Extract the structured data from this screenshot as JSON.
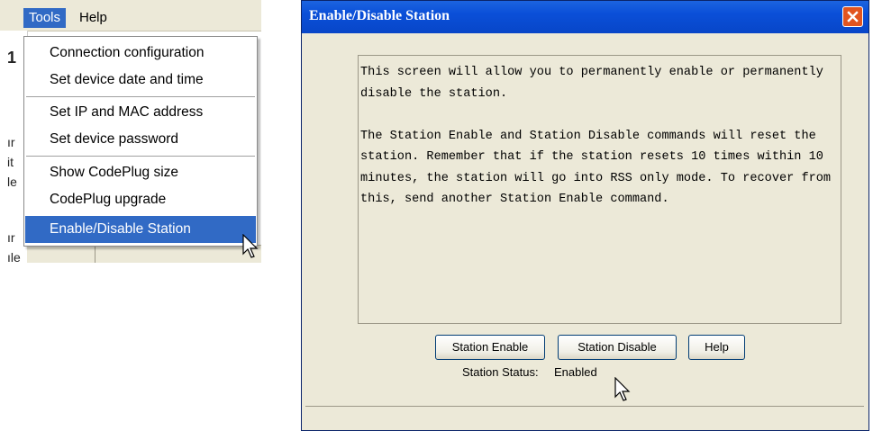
{
  "menu": {
    "menubar": {
      "tools": "Tools",
      "help": "Help"
    },
    "items": [
      "Connection configuration",
      "Set device date and time",
      "Set IP and MAC address",
      "Set device password",
      "Show CodePlug size",
      "CodePlug upgrade",
      "Enable/Disable Station"
    ],
    "selected_item": "Enable/Disable Station",
    "partial_background_text": [
      "1",
      "ır",
      "it",
      "le",
      "ır",
      "ıle"
    ]
  },
  "dialog": {
    "title": "Enable/Disable Station",
    "description_p1": "This screen will allow you to permanently enable or permanently disable the station.",
    "description_p2": "The Station Enable and Station Disable commands will reset the station. Remember that if the station resets 10 times within 10 minutes, the station will go into RSS only mode.  To recover from this, send another Station Enable command.",
    "buttons": {
      "enable": "Station Enable",
      "disable": "Station Disable",
      "help": "Help"
    },
    "status_label": "Station Status:",
    "status_value": "Enabled"
  },
  "colors": {
    "menu_highlight": "#316ac5",
    "titlebar": "#0a4fd8",
    "dialog_bg": "#ece9d8",
    "close_button": "#e2541f"
  }
}
